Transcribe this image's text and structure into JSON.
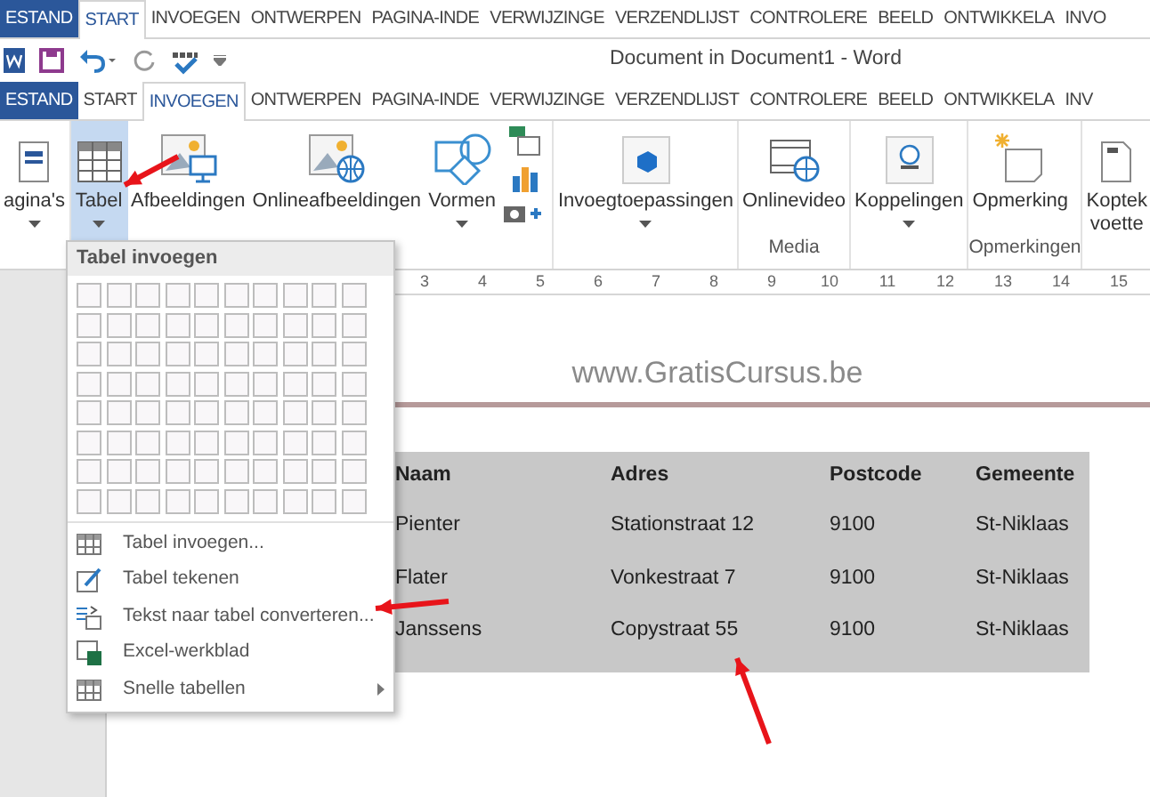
{
  "tab_strip_top": [
    {
      "label": "ESTAND",
      "kind": "file",
      "selected": false
    },
    {
      "label": "START",
      "kind": "tab",
      "selected": true
    },
    {
      "label": "INVOEGEN",
      "kind": "tab",
      "selected": false
    },
    {
      "label": "ONTWERPEN",
      "kind": "tab",
      "selected": false
    },
    {
      "label": "PAGINA-INDE",
      "kind": "tab",
      "selected": false
    },
    {
      "label": "VERWIJZINGE",
      "kind": "tab",
      "selected": false
    },
    {
      "label": "VERZENDLIJST",
      "kind": "tab",
      "selected": false
    },
    {
      "label": "CONTROLERE",
      "kind": "tab",
      "selected": false
    },
    {
      "label": "BEELD",
      "kind": "tab",
      "selected": false
    },
    {
      "label": "ONTWIKKELA",
      "kind": "tab",
      "selected": false
    },
    {
      "label": "INVO",
      "kind": "tab",
      "selected": false
    }
  ],
  "title_bar": {
    "title": "Document in Document1 - Word"
  },
  "tab_strip": [
    {
      "label": "ESTAND",
      "kind": "file",
      "selected": false
    },
    {
      "label": "START",
      "kind": "tab",
      "selected": false
    },
    {
      "label": "INVOEGEN",
      "kind": "tab",
      "selected": true
    },
    {
      "label": "ONTWERPEN",
      "kind": "tab",
      "selected": false
    },
    {
      "label": "PAGINA-INDE",
      "kind": "tab",
      "selected": false
    },
    {
      "label": "VERWIJZINGE",
      "kind": "tab",
      "selected": false
    },
    {
      "label": "VERZENDLIJST",
      "kind": "tab",
      "selected": false
    },
    {
      "label": "CONTROLERE",
      "kind": "tab",
      "selected": false
    },
    {
      "label": "BEELD",
      "kind": "tab",
      "selected": false
    },
    {
      "label": "ONTWIKKELA",
      "kind": "tab",
      "selected": false
    },
    {
      "label": "INV",
      "kind": "tab",
      "selected": false
    }
  ],
  "ribbon": {
    "groups": [
      {
        "buttons": [
          {
            "label": "agina's",
            "kind": "pages",
            "dropdown": true,
            "selected": false
          }
        ]
      },
      {
        "buttons": [
          {
            "label": "Tabel",
            "kind": "table",
            "dropdown": true,
            "selected": true
          }
        ]
      },
      {
        "buttons": [
          {
            "label": "Afbeeldingen",
            "kind": "picture",
            "dropdown": false,
            "selected": false
          },
          {
            "label": "Onlineafbeeldingen",
            "kind": "online_picture",
            "dropdown": false,
            "selected": false
          },
          {
            "label": "Vormen",
            "kind": "shapes",
            "dropdown": true,
            "selected": false
          },
          {
            "kind": "small_icons"
          }
        ]
      },
      {
        "buttons": [
          {
            "label": "Invoegtoepassingen",
            "kind": "addin",
            "dropdown": true,
            "selected": false
          }
        ]
      },
      {
        "label": "Media",
        "buttons": [
          {
            "label": "Onlinevideo",
            "kind": "video",
            "dropdown": false,
            "selected": false
          }
        ]
      },
      {
        "buttons": [
          {
            "label": "Koppelingen",
            "kind": "link",
            "dropdown": true,
            "selected": false
          }
        ]
      },
      {
        "label": "Opmerkingen",
        "buttons": [
          {
            "label": "Opmerking",
            "kind": "comment",
            "dropdown": false,
            "selected": false
          }
        ]
      },
      {
        "buttons": [
          {
            "label": "Koptek",
            "label_2": "voette",
            "kind": "header",
            "dropdown": false,
            "selected": false
          }
        ]
      }
    ]
  },
  "ruler": [
    "3",
    "4",
    "5",
    "6",
    "7",
    "8",
    "9",
    "10",
    "11",
    "12",
    "13",
    "14",
    "15"
  ],
  "document": {
    "header_text": "www.GratisCursus.be",
    "table": {
      "columns": [
        "Naam",
        "Adres",
        "Postcode",
        "Gemeente"
      ],
      "rows": [
        [
          "Pienter",
          "Stationstraat 12",
          "9100",
          "St-Niklaas"
        ],
        [
          "Flater",
          "Vonkestraat 7",
          "9100",
          "St-Niklaas"
        ],
        [
          "Janssens",
          "Copystraat 55",
          "9100",
          "St-Niklaas"
        ]
      ]
    }
  },
  "table_menu": {
    "title": "Tabel invoegen",
    "items": [
      {
        "label": "Tabel invoegen...",
        "kind": "table",
        "disabled": false,
        "submenu": false
      },
      {
        "label": "Tabel tekenen",
        "kind": "draw",
        "disabled": false,
        "submenu": false
      },
      {
        "label": "Tekst naar tabel converteren...",
        "kind": "convert",
        "disabled": false,
        "submenu": false
      },
      {
        "label": "Excel-werkblad",
        "kind": "excel",
        "disabled": false,
        "submenu": false
      },
      {
        "label": "Snelle tabellen",
        "kind": "table",
        "disabled": false,
        "submenu": true
      }
    ]
  }
}
